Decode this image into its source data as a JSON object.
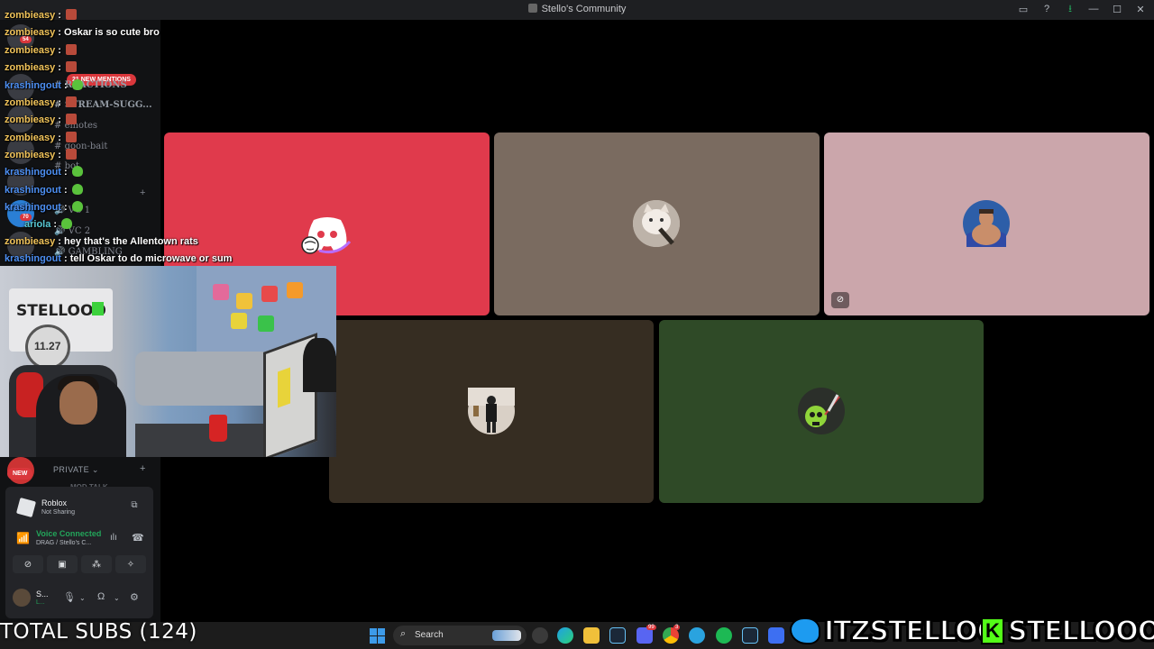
{
  "window": {
    "title": "Stello's Community"
  },
  "sidebar": {
    "channels": [
      {
        "label": "REACTIONS",
        "icon": "hash-icon"
      },
      {
        "label": "STREAM-SUGG...",
        "icon": "hash-icon"
      },
      {
        "label": "emotes",
        "icon": "hash-icon"
      },
      {
        "label": "goon-bait",
        "icon": "hash-icon"
      },
      {
        "label": "bot",
        "icon": "hash-icon"
      },
      {
        "label": "VC 1",
        "icon": "speaker-icon"
      },
      {
        "label": "VC 2",
        "icon": "speaker-icon"
      },
      {
        "label": "GAMBLING",
        "icon": "speaker-icon"
      }
    ],
    "mentions_badge": "21 NEW MENTIONS",
    "new_badge": "NEW",
    "private_header": "PRIVATE",
    "peek_channel": "MOD TALK",
    "server_badges": [
      "54",
      "70"
    ]
  },
  "panel": {
    "activity": {
      "title": "Roblox",
      "subtitle": "Not Sharing"
    },
    "voice": {
      "status": "Voice Connected",
      "channel": "DRAG / Stello's C..."
    },
    "user": {
      "name": "S...",
      "status": "L..."
    }
  },
  "chat": {
    "lines": [
      {
        "user": "zombieasy",
        "msg": "",
        "emote": "red",
        "color": "yellow"
      },
      {
        "user": "zombieasy",
        "msg": "Oskar is so cute bro",
        "emote": "",
        "color": "yellow"
      },
      {
        "user": "zombieasy",
        "msg": "",
        "emote": "red",
        "color": "yellow"
      },
      {
        "user": "zombieasy",
        "msg": "",
        "emote": "red",
        "color": "yellow"
      },
      {
        "user": "krashingout",
        "msg": "",
        "emote": "green",
        "color": "blue"
      },
      {
        "user": "zombieasy",
        "msg": "",
        "emote": "red",
        "color": "yellow"
      },
      {
        "user": "zombieasy",
        "msg": "",
        "emote": "red",
        "color": "yellow"
      },
      {
        "user": "zombieasy",
        "msg": "",
        "emote": "red",
        "color": "yellow"
      },
      {
        "user": "zombieasy",
        "msg": "",
        "emote": "red",
        "color": "yellow"
      },
      {
        "user": "krashingout",
        "msg": "",
        "emote": "green",
        "color": "blue"
      },
      {
        "user": "krashingout",
        "msg": "",
        "emote": "green",
        "color": "blue"
      },
      {
        "user": "krashingout",
        "msg": "",
        "emote": "green",
        "color": "blue"
      },
      {
        "user": "ariola",
        "msg": "",
        "emote": "green",
        "color": "teal"
      },
      {
        "user": "zombieasy",
        "msg": "hey that's the Allentown rats",
        "emote": "",
        "color": "yellow"
      },
      {
        "user": "krashingout",
        "msg": "tell Oskar to do microwave or sum",
        "emote": "",
        "color": "blue"
      }
    ]
  },
  "webcam": {
    "banner_text": "STELLOOO",
    "circle_text": "11.27"
  },
  "call": {
    "tiles": [
      {
        "bg": "#e03a4c",
        "avatar": "discord-logo",
        "avatar_color": "#ffffff"
      },
      {
        "bg": "#7a6b60",
        "avatar": "cat-avatar",
        "avatar_color": "#cfc4b9"
      },
      {
        "bg": "#cba6ab",
        "avatar": "wrestler-avatar",
        "avatar_color": "#2d5ea8",
        "icon": "screen-share-off-icon"
      },
      {
        "bg": "#362d22",
        "avatar": "person-avatar",
        "avatar_color": "#d9d0c6"
      },
      {
        "bg": "#2f4a27",
        "avatar": "skull-avatar",
        "avatar_color": "#2b2f2a"
      }
    ]
  },
  "overlay": {
    "subs": "TOTAL SUBS (124)",
    "twitter": "ITZSTELLOO",
    "kick": "STELLOOO"
  },
  "taskbar": {
    "search_label": "Search",
    "apps": [
      "task-view",
      "edge",
      "file-explorer",
      "steam",
      "discord",
      "chrome",
      "telegram",
      "spotify",
      "steam-2",
      "app-blue"
    ],
    "discord_badge": "99",
    "chrome_badge": "3"
  }
}
